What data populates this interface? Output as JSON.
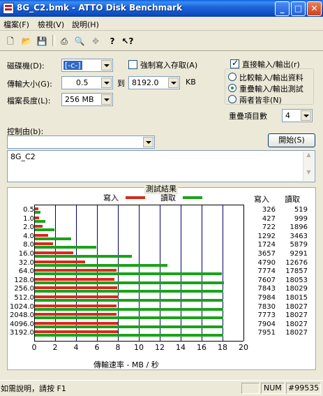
{
  "window": {
    "title": "8G_C2.bmk - ATTO Disk Benchmark"
  },
  "menu": [
    "檔案(F)",
    "檢視(V)",
    "說明(H)"
  ],
  "toolbar": [
    "new-icon",
    "open-icon",
    "save-icon",
    "print-icon",
    "print-preview-icon",
    "move-icon",
    "help-icon",
    "context-help-icon"
  ],
  "settings": {
    "drive_label": "磁碟機(D):",
    "drive_value": "[-c-]",
    "force_write_label": "強制寫入存取(A)",
    "transfer_label": "傳輸大小(G):",
    "transfer_from": "0.5",
    "to_label": "到",
    "transfer_to": "8192.0",
    "unit": "KB",
    "length_label": "檔案長度(L):",
    "length_value": "256 MB",
    "direct_io_label": "直接輸入/輸出(r)",
    "compare_label": "比較輸入/輸出資料",
    "overlap_label": "重疊輸入/輸出測試",
    "neither_label": "兩者皆非(N)",
    "queue_label": "重疊項目數",
    "queue_value": "4",
    "control_label": "控制由(b):",
    "start_button": "開始(S)",
    "description": "8G_C2"
  },
  "results": {
    "title": "測試結果",
    "legend_write": "寫入",
    "legend_read": "讀取",
    "col_write": "寫入",
    "col_read": "讀取",
    "xlabel": "傳輸速率 - MB / 秒",
    "xticks": [
      "0",
      "2",
      "4",
      "6",
      "8",
      "10",
      "12",
      "14",
      "16",
      "18",
      "20"
    ]
  },
  "chart_data": {
    "type": "bar",
    "title": "測試結果",
    "xlabel": "傳輸速率 - MB / 秒",
    "xlim": [
      0,
      20
    ],
    "categories": [
      "0.5",
      "1.0",
      "2.0",
      "4.0",
      "8.0",
      "16.0",
      "32.0",
      "64.0",
      "128.0",
      "256.0",
      "512.0",
      "1024.0",
      "2048.0",
      "4096.0",
      "3192.0"
    ],
    "series": [
      {
        "name": "寫入",
        "color": "#d62a1d",
        "values": [
          326,
          427,
          722,
          1292,
          1724,
          3657,
          4790,
          7774,
          7607,
          7843,
          7984,
          7830,
          7773,
          7904,
          7951
        ]
      },
      {
        "name": "讀取",
        "color": "#1aa31a",
        "values": [
          519,
          999,
          1896,
          3463,
          5879,
          9291,
          12676,
          17857,
          18053,
          18029,
          18015,
          18027,
          18027,
          18027,
          18027
        ]
      }
    ]
  },
  "status": {
    "help_text": "如需說明，請按 F1",
    "num": "NUM",
    "extra": "#99535"
  }
}
